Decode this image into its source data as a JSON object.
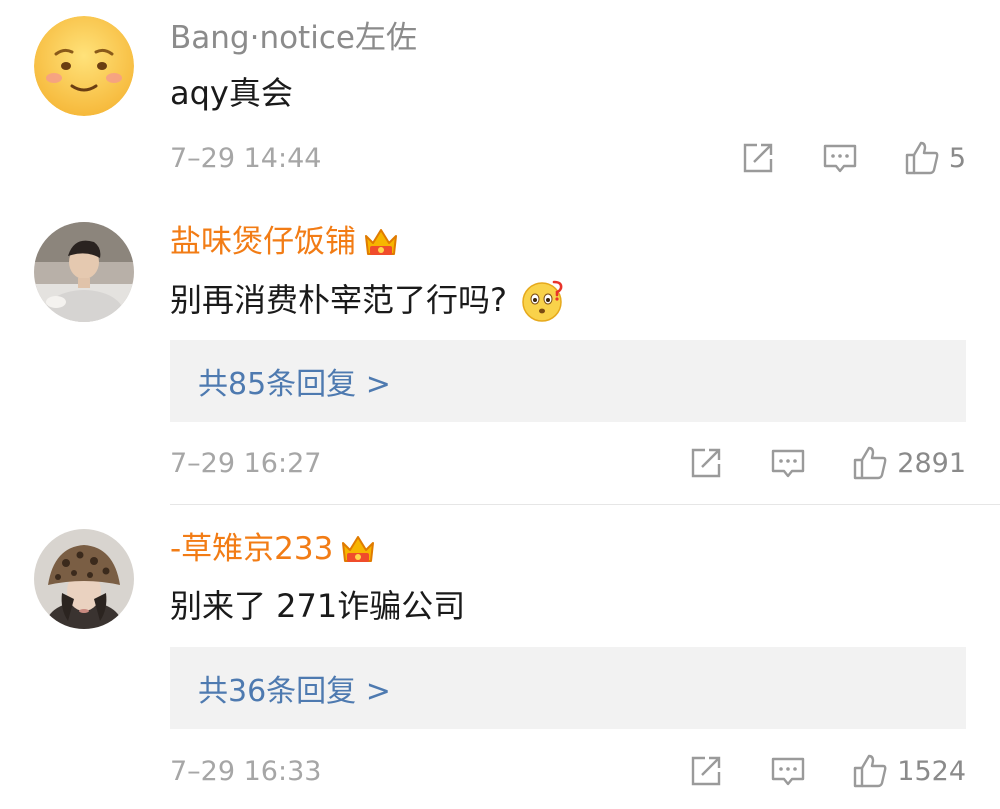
{
  "comments": [
    {
      "user": "Bang·notice左佐",
      "text": "aqy真会",
      "time": "7–29 14:44",
      "likes": "5"
    },
    {
      "user": "盐味煲仔饭铺",
      "text": "别再消费朴宰范了行吗?",
      "replies_label": "共85条回复 >",
      "time": "7–29 16:27",
      "likes": "2891"
    },
    {
      "user": "-草雉京233",
      "text": "别来了 271诈骗公司",
      "replies_label": "共36条回复 >",
      "time": "7–29 16:33",
      "likes": "1524"
    }
  ],
  "icons": {
    "vip_badge": "crown-icon",
    "share": "share-icon",
    "reply": "comment-icon",
    "like": "thumbs-up-icon",
    "emoji": "thinking-emoji"
  },
  "colors": {
    "vip_name": "#f27c15",
    "plain_name": "#8b8b8b",
    "reply_link": "#4e7ab0",
    "reply_bg": "#f2f2f2"
  }
}
